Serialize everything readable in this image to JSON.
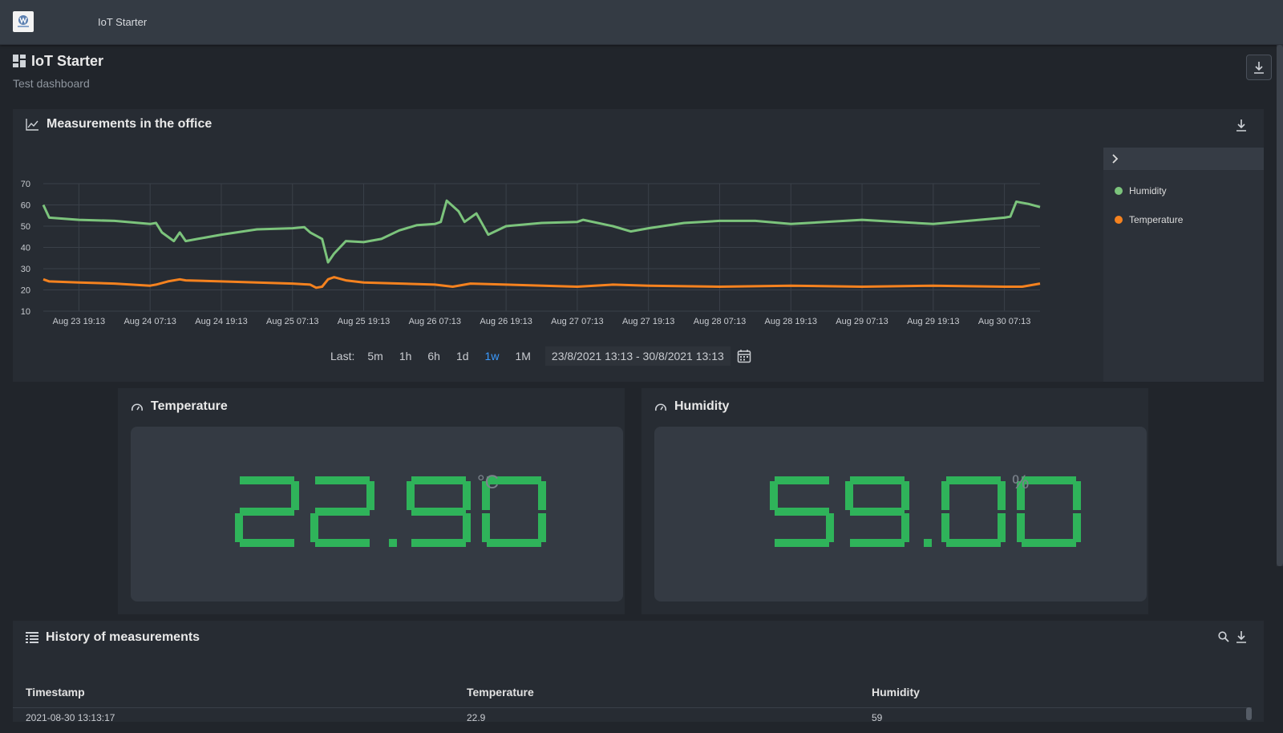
{
  "topbar": {
    "title": "IoT Starter"
  },
  "page": {
    "title": "IoT Starter",
    "subtitle": "Test dashboard"
  },
  "chart_panel": {
    "title": "Measurements in the office",
    "legend": [
      {
        "name": "Humidity",
        "color": "#7cc47c"
      },
      {
        "name": "Temperature",
        "color": "#f5821f"
      }
    ],
    "range": {
      "label": "Last:",
      "options": [
        "5m",
        "1h",
        "6h",
        "1d",
        "1w",
        "1M"
      ],
      "active": "1w",
      "dates": "23/8/2021 13:13 - 30/8/2021 13:13"
    }
  },
  "chart_data": {
    "type": "line",
    "x": [
      "Aug 23 19:13",
      "Aug 24 07:13",
      "Aug 24 19:13",
      "Aug 25 07:13",
      "Aug 25 19:13",
      "Aug 26 07:13",
      "Aug 26 19:13",
      "Aug 27 07:13",
      "Aug 27 19:13",
      "Aug 28 07:13",
      "Aug 28 19:13",
      "Aug 29 07:13",
      "Aug 29 19:13",
      "Aug 30 07:13"
    ],
    "y_ticks": [
      10,
      20,
      30,
      40,
      50,
      60,
      70
    ],
    "ylim": [
      10,
      70
    ],
    "xlim": [
      "Aug 23 13:13",
      "Aug 30 13:13"
    ],
    "grid": true,
    "legend_position": "right",
    "series": [
      {
        "name": "Humidity",
        "color": "#7cc47c",
        "points": [
          [
            "Aug 23 13:13",
            60
          ],
          [
            "Aug 23 14:13",
            54
          ],
          [
            "Aug 23 19:13",
            53
          ],
          [
            "Aug 24 01:13",
            52.5
          ],
          [
            "Aug 24 07:13",
            51
          ],
          [
            "Aug 24 08:13",
            51.5
          ],
          [
            "Aug 24 09:13",
            47
          ],
          [
            "Aug 24 11:13",
            43
          ],
          [
            "Aug 24 12:13",
            47
          ],
          [
            "Aug 24 13:13",
            43
          ],
          [
            "Aug 24 15:13",
            44
          ],
          [
            "Aug 24 19:13",
            46
          ],
          [
            "Aug 25 01:13",
            48.5
          ],
          [
            "Aug 25 07:13",
            49
          ],
          [
            "Aug 25 09:13",
            49.5
          ],
          [
            "Aug 25 10:13",
            47
          ],
          [
            "Aug 25 12:13",
            44
          ],
          [
            "Aug 25 13:13",
            33
          ],
          [
            "Aug 25 14:13",
            37
          ],
          [
            "Aug 25 16:13",
            43
          ],
          [
            "Aug 25 19:13",
            42.5
          ],
          [
            "Aug 25 22:13",
            44
          ],
          [
            "Aug 26 01:13",
            48
          ],
          [
            "Aug 26 04:13",
            50.5
          ],
          [
            "Aug 26 07:13",
            51
          ],
          [
            "Aug 26 08:13",
            52
          ],
          [
            "Aug 26 09:13",
            62
          ],
          [
            "Aug 26 11:13",
            57
          ],
          [
            "Aug 26 12:13",
            52
          ],
          [
            "Aug 26 14:13",
            56
          ],
          [
            "Aug 26 15:13",
            51
          ],
          [
            "Aug 26 16:13",
            46
          ],
          [
            "Aug 26 19:13",
            50
          ],
          [
            "Aug 27 01:13",
            51.5
          ],
          [
            "Aug 27 07:13",
            52
          ],
          [
            "Aug 27 08:13",
            53
          ],
          [
            "Aug 27 13:13",
            50
          ],
          [
            "Aug 27 16:13",
            47.5
          ],
          [
            "Aug 27 19:13",
            49
          ],
          [
            "Aug 28 01:13",
            51.5
          ],
          [
            "Aug 28 07:13",
            52.5
          ],
          [
            "Aug 28 13:13",
            52.5
          ],
          [
            "Aug 28 19:13",
            51
          ],
          [
            "Aug 29 07:13",
            53
          ],
          [
            "Aug 29 19:13",
            51
          ],
          [
            "Aug 30 07:13",
            54
          ],
          [
            "Aug 30 08:13",
            54.5
          ],
          [
            "Aug 30 09:13",
            61.5
          ],
          [
            "Aug 30 11:13",
            60.5
          ],
          [
            "Aug 30 13:13",
            59
          ]
        ]
      },
      {
        "name": "Temperature",
        "color": "#f5821f",
        "points": [
          [
            "Aug 23 13:13",
            25
          ],
          [
            "Aug 23 14:13",
            24
          ],
          [
            "Aug 23 19:13",
            23.5
          ],
          [
            "Aug 24 01:13",
            23
          ],
          [
            "Aug 24 07:13",
            22
          ],
          [
            "Aug 24 08:13",
            22.5
          ],
          [
            "Aug 24 10:13",
            24
          ],
          [
            "Aug 24 12:13",
            25
          ],
          [
            "Aug 24 13:13",
            24.5
          ],
          [
            "Aug 24 19:13",
            24
          ],
          [
            "Aug 25 01:13",
            23.5
          ],
          [
            "Aug 25 07:13",
            23
          ],
          [
            "Aug 25 10:13",
            22.5
          ],
          [
            "Aug 25 11:13",
            21
          ],
          [
            "Aug 25 12:13",
            21.5
          ],
          [
            "Aug 25 13:13",
            25
          ],
          [
            "Aug 25 14:13",
            26
          ],
          [
            "Aug 25 16:13",
            24.5
          ],
          [
            "Aug 25 19:13",
            23.5
          ],
          [
            "Aug 26 07:13",
            22.5
          ],
          [
            "Aug 26 10:13",
            21.5
          ],
          [
            "Aug 26 13:13",
            23
          ],
          [
            "Aug 26 19:13",
            22.5
          ],
          [
            "Aug 27 07:13",
            21.5
          ],
          [
            "Aug 27 13:13",
            22.5
          ],
          [
            "Aug 27 19:13",
            22
          ],
          [
            "Aug 28 07:13",
            21.5
          ],
          [
            "Aug 28 19:13",
            22
          ],
          [
            "Aug 29 07:13",
            21.5
          ],
          [
            "Aug 29 19:13",
            22
          ],
          [
            "Aug 30 07:13",
            21.5
          ],
          [
            "Aug 30 10:13",
            21.5
          ],
          [
            "Aug 30 13:13",
            23
          ]
        ]
      }
    ]
  },
  "temperature": {
    "title": "Temperature",
    "value": "22.90",
    "unit": "°C",
    "color": "#2fb35a"
  },
  "humidity": {
    "title": "Humidity",
    "value": "59.00",
    "unit": "%",
    "color": "#2fb35a"
  },
  "history": {
    "title": "History of measurements",
    "columns": [
      "Timestamp",
      "Temperature",
      "Humidity"
    ],
    "rows": [
      [
        "2021-08-30 13:13:17",
        "22.9",
        "59"
      ]
    ]
  }
}
